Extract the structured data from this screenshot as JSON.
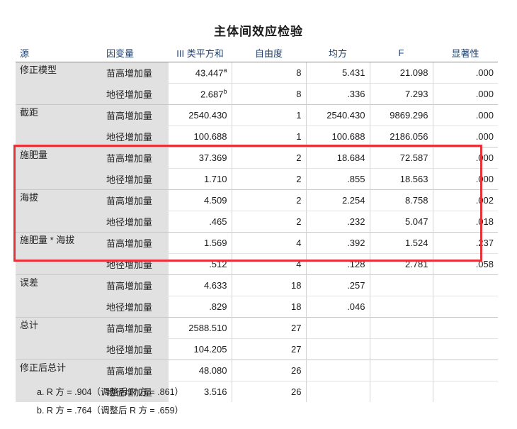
{
  "title": "主体间效应检验",
  "headers": [
    "源",
    "因变量",
    "III 类平方和",
    "自由度",
    "均方",
    "F",
    "显著性"
  ],
  "rows": [
    {
      "source": "修正模型",
      "items": [
        {
          "dep": "苗高增加量",
          "ss": "43.447",
          "sup": "a",
          "df": "8",
          "ms": "5.431",
          "f": "21.098",
          "sig": ".000"
        },
        {
          "dep": "地径增加量",
          "ss": "2.687",
          "sup": "b",
          "df": "8",
          "ms": ".336",
          "f": "7.293",
          "sig": ".000"
        }
      ]
    },
    {
      "source": "截距",
      "items": [
        {
          "dep": "苗高增加量",
          "ss": "2540.430",
          "df": "1",
          "ms": "2540.430",
          "f": "9869.296",
          "sig": ".000"
        },
        {
          "dep": "地径增加量",
          "ss": "100.688",
          "df": "1",
          "ms": "100.688",
          "f": "2186.056",
          "sig": ".000"
        }
      ]
    },
    {
      "source": "施肥量",
      "items": [
        {
          "dep": "苗高增加量",
          "ss": "37.369",
          "df": "2",
          "ms": "18.684",
          "f": "72.587",
          "sig": ".000"
        },
        {
          "dep": "地径增加量",
          "ss": "1.710",
          "df": "2",
          "ms": ".855",
          "f": "18.563",
          "sig": ".000"
        }
      ]
    },
    {
      "source": "海拔",
      "items": [
        {
          "dep": "苗高增加量",
          "ss": "4.509",
          "df": "2",
          "ms": "2.254",
          "f": "8.758",
          "sig": ".002"
        },
        {
          "dep": "地径增加量",
          "ss": ".465",
          "df": "2",
          "ms": ".232",
          "f": "5.047",
          "sig": ".018"
        }
      ]
    },
    {
      "source": "施肥量 * 海拔",
      "items": [
        {
          "dep": "苗高增加量",
          "ss": "1.569",
          "df": "4",
          "ms": ".392",
          "f": "1.524",
          "sig": ".237"
        },
        {
          "dep": "地径增加量",
          "ss": ".512",
          "df": "4",
          "ms": ".128",
          "f": "2.781",
          "sig": ".058"
        }
      ]
    },
    {
      "source": "误差",
      "items": [
        {
          "dep": "苗高增加量",
          "ss": "4.633",
          "df": "18",
          "ms": ".257",
          "f": "",
          "sig": ""
        },
        {
          "dep": "地径增加量",
          "ss": ".829",
          "df": "18",
          "ms": ".046",
          "f": "",
          "sig": ""
        }
      ]
    },
    {
      "source": "总计",
      "items": [
        {
          "dep": "苗高增加量",
          "ss": "2588.510",
          "df": "27",
          "ms": "",
          "f": "",
          "sig": ""
        },
        {
          "dep": "地径增加量",
          "ss": "104.205",
          "df": "27",
          "ms": "",
          "f": "",
          "sig": ""
        }
      ]
    },
    {
      "source": "修正后总计",
      "items": [
        {
          "dep": "苗高增加量",
          "ss": "48.080",
          "df": "26",
          "ms": "",
          "f": "",
          "sig": ""
        },
        {
          "dep": "地径增加量",
          "ss": "3.516",
          "df": "26",
          "ms": "",
          "f": "",
          "sig": ""
        }
      ]
    }
  ],
  "footnotes": [
    "a. R 方 = .904（调整后 R 方 = .861）",
    "b. R 方 = .764（调整后 R 方 = .659）"
  ],
  "highlight_color": "#e8323a"
}
